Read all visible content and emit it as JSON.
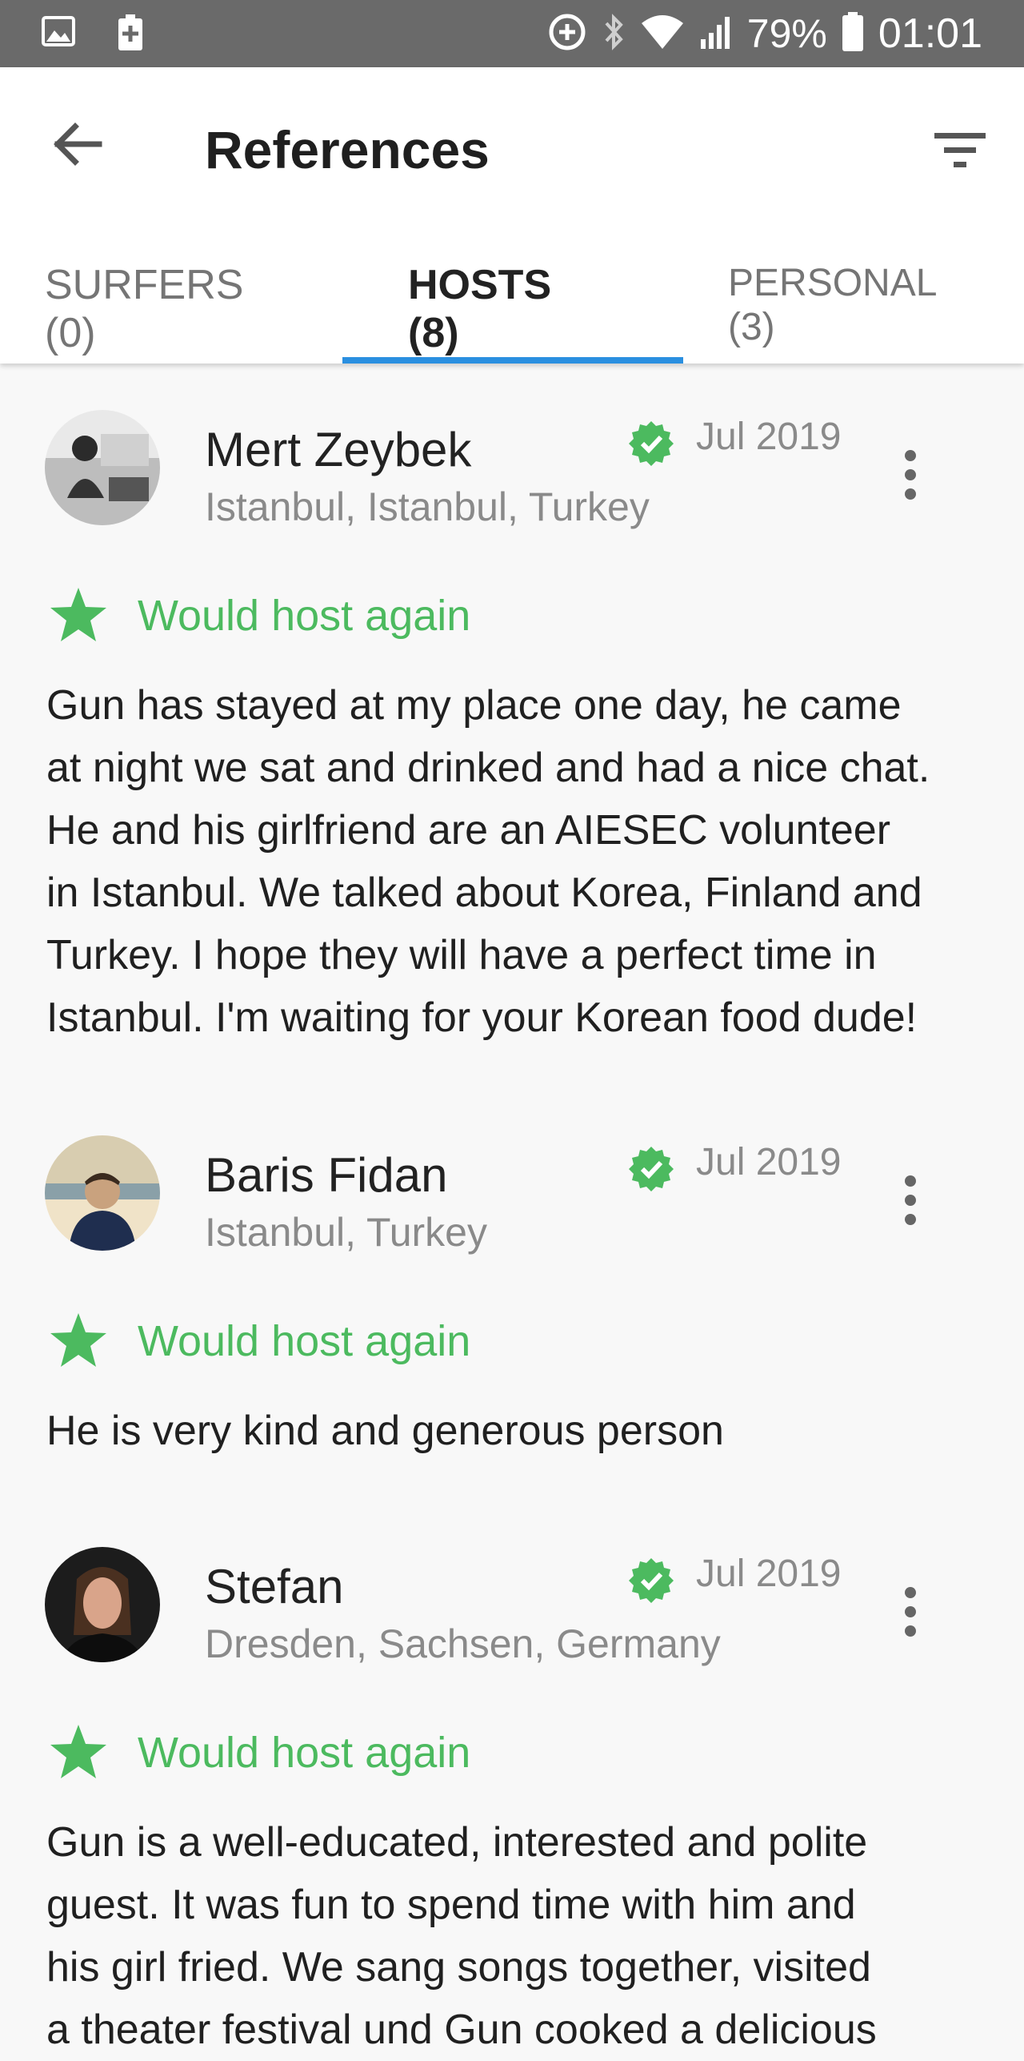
{
  "status_bar": {
    "left_icons": [
      "gallery-icon",
      "battery-saver-icon"
    ],
    "right_icons": [
      "data-saver-icon",
      "bluetooth-icon",
      "wifi-icon",
      "signal-icon",
      "battery-icon"
    ],
    "battery": "79%",
    "time": "01:01"
  },
  "header": {
    "title": "References",
    "back_icon": "arrow-back-icon",
    "filter_icon": "filter-icon"
  },
  "tabs": [
    {
      "label": "SURFERS (0)",
      "active": false
    },
    {
      "label": "HOSTS (8)",
      "active": true
    },
    {
      "label": "PERSONAL (3)",
      "active": false
    }
  ],
  "colors": {
    "accent": "#2a8fe0",
    "positive": "#4cba5f",
    "status_bar": "#6a6a6a"
  },
  "references": [
    {
      "name": "Mert Zeybek",
      "location": "Istanbul, Istanbul, Turkey",
      "date": "Jul 2019",
      "verified": true,
      "recommendation": "Would host again",
      "text_lines": [
        "Gun has stayed at my place one day, he came",
        "at night we sat and drinked and had a nice chat.",
        "He and his girlfriend are an AIESEC volunteer",
        "in Istanbul. We talked about Korea, Finland and",
        "Turkey. I hope they will have a perfect time in",
        "Istanbul. I'm waiting for your Korean food dude!"
      ]
    },
    {
      "name": "Baris Fidan",
      "location": "Istanbul, Turkey",
      "date": "Jul 2019",
      "verified": true,
      "recommendation": "Would host again",
      "text_lines": [
        "He is very kind and generous person"
      ]
    },
    {
      "name": "Stefan",
      "location": "Dresden, Sachsen, Germany",
      "date": "Jul 2019",
      "verified": true,
      "recommendation": "Would host again",
      "text_lines": [
        "Gun is a well-educated, interested and polite",
        "guest. It was fun to spend time with him and",
        "his girl fried. We sang songs together, visited",
        "a theater festival und Gun cooked a delicious"
      ]
    }
  ]
}
